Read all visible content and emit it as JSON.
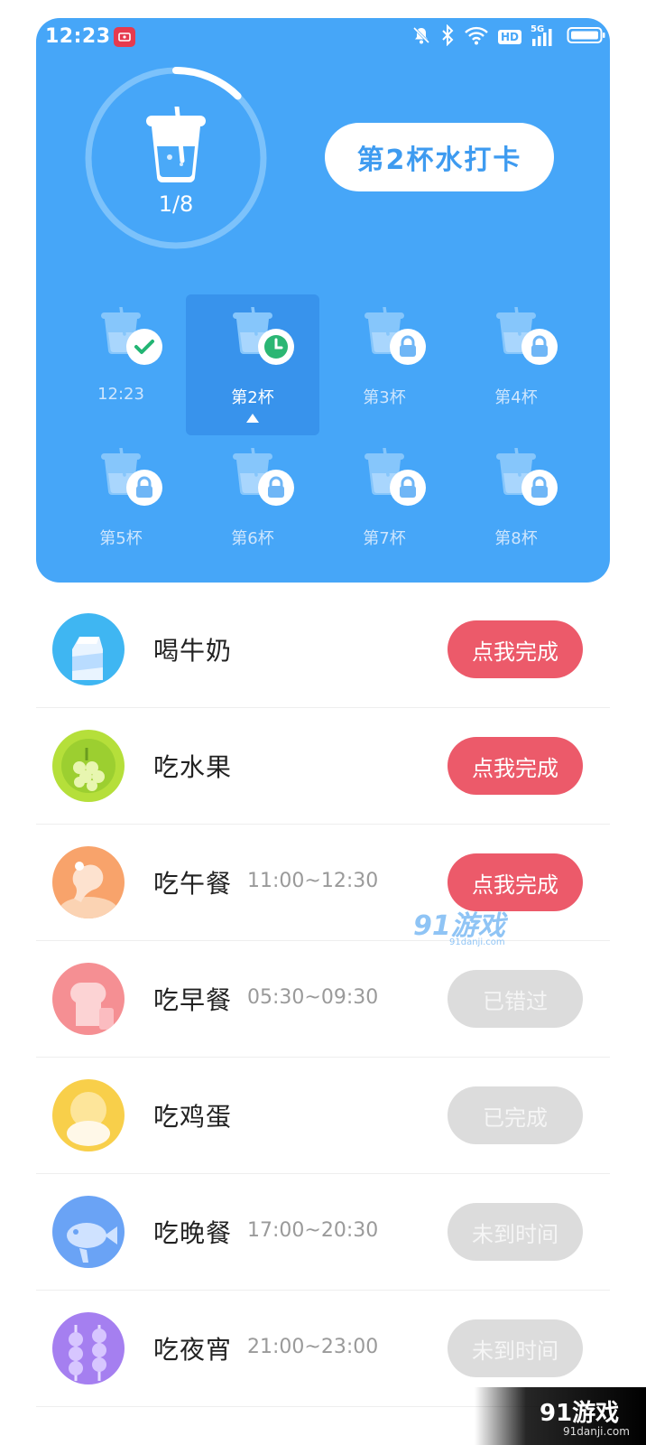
{
  "status_bar": {
    "time": "12:23",
    "network_label": "5G",
    "hd_label": "HD"
  },
  "water": {
    "progress_text": "1/8",
    "progress_fraction": 0.125,
    "checkin_button": "第2杯水打卡",
    "cups": [
      {
        "label": "12:23",
        "state": "done",
        "icon": "check-icon"
      },
      {
        "label": "第2杯",
        "state": "current",
        "icon": "clock-icon"
      },
      {
        "label": "第3杯",
        "state": "locked",
        "icon": "lock-icon"
      },
      {
        "label": "第4杯",
        "state": "locked",
        "icon": "lock-icon"
      },
      {
        "label": "第5杯",
        "state": "locked",
        "icon": "lock-icon"
      },
      {
        "label": "第6杯",
        "state": "locked",
        "icon": "lock-icon"
      },
      {
        "label": "第7杯",
        "state": "locked",
        "icon": "lock-icon"
      },
      {
        "label": "第8杯",
        "state": "locked",
        "icon": "lock-icon"
      }
    ]
  },
  "tasks": [
    {
      "name": "喝牛奶",
      "time": "",
      "button": "点我完成",
      "status": "active",
      "icon": "milk-icon",
      "color": "#3fb6f2"
    },
    {
      "name": "吃水果",
      "time": "",
      "button": "点我完成",
      "status": "active",
      "icon": "grapes-icon",
      "color": "#b5df3a"
    },
    {
      "name": "吃午餐",
      "time": "11:00~12:30",
      "button": "点我完成",
      "status": "active",
      "icon": "drumstick-icon",
      "color": "#f8a36b"
    },
    {
      "name": "吃早餐",
      "time": "05:30~09:30",
      "button": "已错过",
      "status": "missed",
      "icon": "bread-icon",
      "color": "#f58f93"
    },
    {
      "name": "吃鸡蛋",
      "time": "",
      "button": "已完成",
      "status": "done",
      "icon": "egg-icon",
      "color": "#f8cf4a"
    },
    {
      "name": "吃晚餐",
      "time": "17:00~20:30",
      "button": "未到时间",
      "status": "pending",
      "icon": "fish-icon",
      "color": "#6aa3f5"
    },
    {
      "name": "吃夜宵",
      "time": "21:00~23:00",
      "button": "未到时间",
      "status": "pending",
      "icon": "skewer-icon",
      "color": "#a57ff0"
    }
  ],
  "watermark": {
    "text": "91游戏",
    "sub": "91danji.com"
  },
  "corner_logo": {
    "text": "91游戏",
    "sub": "91danji.com"
  }
}
